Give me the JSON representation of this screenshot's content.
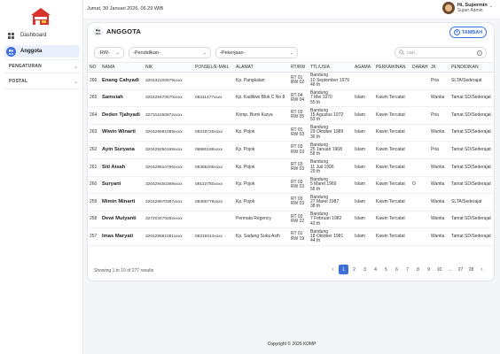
{
  "app": {
    "brand_color": "#3d6fd6",
    "logo_icon": "house-logo"
  },
  "sidebar": {
    "items": [
      {
        "label": "Dashboard",
        "icon": "grid-icon",
        "active": false
      },
      {
        "label": "Anggota",
        "icon": "users-icon",
        "active": true
      }
    ],
    "groups": [
      {
        "label": "PENGATURAN"
      },
      {
        "label": "POSTAL"
      }
    ]
  },
  "topbar": {
    "datetime": "Jumat, 30 Januari 2026, 06.29 WIB",
    "user_name": "Hi, Supermin",
    "user_role": "Super Admin"
  },
  "card": {
    "title": "ANGGOTA",
    "add_label": "TAMBAH",
    "filters": {
      "rw": "-RW-",
      "pendidikan": "-Pendidikan-",
      "pekerjaan": "-Pekerjaan-"
    },
    "search_placeholder": "cari.."
  },
  "table": {
    "headers": [
      "NO",
      "NAMA",
      "NIK",
      "PONSEL/E-MAIL",
      "ALAMAT",
      "RT/RW",
      "TTL/USIA",
      "AGAMA",
      "PERKAWINAN",
      "DARAH",
      "JK",
      "PENDIDIKAN"
    ],
    "rows": [
      {
        "no": "266",
        "nama": "Enang Cahyadi",
        "nik": "320432100979xxxx",
        "ponsel": "",
        "alamat": "Kp. Pangkalan",
        "rt": "RT 01",
        "rw": "RW 02",
        "ttl1": "Bandung",
        "ttl2": "10 September 1979",
        "ttl3": "46 th",
        "agama": "",
        "kawin": "",
        "darah": "",
        "jk": "Pria",
        "pend": "SLTA/Sederajat"
      },
      {
        "no": "265",
        "nama": "Samsiah",
        "nik": "320429470570xxxx",
        "ponsel": "08311477xxxx",
        "alamat": "Kp. Kadikiwi Blok C No 8",
        "rt": "RT 04",
        "rw": "RW 04",
        "ttl1": "Bandung",
        "ttl2": "7 Mei 1970",
        "ttl3": "55 th",
        "agama": "Islam",
        "kawin": "Kawin Tercatat",
        "darah": "",
        "jk": "Wanita",
        "pend": "Tamat SD/Sederajat"
      },
      {
        "no": "264",
        "nama": "Deden Tjahyadi",
        "nik": "327316150872xxxx",
        "ponsel": "",
        "alamat": "Komp. Bumi Karya",
        "rt": "RT 03",
        "rw": "RW 05",
        "ttl1": "Bandung",
        "ttl2": "15 Agustus 1972",
        "ttl3": "53 th",
        "agama": "Islam",
        "kawin": "Kawin Tercatat",
        "darah": "",
        "jk": "Pria",
        "pend": "Tamat SD/Sederajat"
      },
      {
        "no": "263",
        "nama": "Wiwin Winarti",
        "nik": "320429691089xxxx",
        "ponsel": "08318726xxxx",
        "alamat": "Kp. Pojok",
        "rt": "RT 01",
        "rw": "RW 03",
        "ttl1": "Bandung",
        "ttl2": "29 Oktober 1989",
        "ttl3": "36 th",
        "agama": "Islam",
        "kawin": "Kawin Tercatat",
        "darah": "",
        "jk": "Wanita",
        "pend": "Tamat SD/Sederajat"
      },
      {
        "no": "262",
        "nama": "Ayin Suryana",
        "nik": "320429250168xxxx",
        "ponsel": "08880189xxxx",
        "alamat": "Kp. Pojok",
        "rt": "RT 03",
        "rw": "RW 03",
        "ttl1": "Bandung",
        "ttl2": "25 Januari 1968",
        "ttl3": "58 th",
        "agama": "Islam",
        "kawin": "Kawin Tercatat",
        "darah": "",
        "jk": "Pria",
        "pend": "Tamat SD/Sederajat"
      },
      {
        "no": "261",
        "nama": "Siti Aisah",
        "nik": "320429510796xxxx",
        "ponsel": "08386206xxxx",
        "alamat": "Kp. Pojok",
        "rt": "RT 03",
        "rw": "RW 03",
        "ttl1": "Bandung",
        "ttl2": "11 Juli 1996",
        "ttl3": "29 th",
        "agama": "Islam",
        "kawin": "Kawin Tercatat",
        "darah": "",
        "jk": "Wanita",
        "pend": "Tamat SD/Sederajat"
      },
      {
        "no": "260",
        "nama": "Suryani",
        "nik": "320429450369xxxx",
        "ponsel": "08122750xxxx",
        "alamat": "Kp. Pojok",
        "rt": "RT 03",
        "rw": "RW 03",
        "ttl1": "Bandung",
        "ttl2": "5 Maret 1969",
        "ttl3": "56 th",
        "agama": "Islam",
        "kawin": "Kawin Tercatat",
        "darah": "O",
        "jk": "Wanita",
        "pend": "Tamat SD/Sederajat"
      },
      {
        "no": "259",
        "nama": "Mimin Minarti",
        "nik": "320429670387xxxx",
        "ponsel": "08386779xxxx",
        "alamat": "Kp. Pojok",
        "rt": "RT 03",
        "rw": "RW 03",
        "ttl1": "Bandung",
        "ttl2": "27 Maret 1987",
        "ttl3": "38 th",
        "agama": "Islam",
        "kawin": "Kawin Tercatat",
        "darah": "",
        "jk": "Wanita",
        "pend": "SLTA/Sederajat"
      },
      {
        "no": "258",
        "nama": "Dewi Mulyanti",
        "nik": "327203470282xxxx",
        "ponsel": "",
        "alamat": "Permata Regency",
        "rt": "RT 03",
        "rw": "RW 22",
        "ttl1": "Bandung",
        "ttl2": "7 Februari 1982",
        "ttl3": "43 th",
        "agama": "Islam",
        "kawin": "Kawin Tercatat",
        "darah": "",
        "jk": "Wanita",
        "pend": "Tamat SD/Sederajat"
      },
      {
        "no": "257",
        "nama": "Imas Maryati",
        "nik": "320429581081xxxx",
        "ponsel": "08319214xxxx",
        "alamat": "Kp. Sadang Suka Asih",
        "rt": "RT 01",
        "rw": "RW 19",
        "ttl1": "Bandung",
        "ttl2": "18 Oktober 1981",
        "ttl3": "44 th",
        "agama": "Islam",
        "kawin": "Kawin Tercatat",
        "darah": "",
        "jk": "Wanita",
        "pend": "Tamat SD/Sederajat"
      }
    ]
  },
  "pagination": {
    "results": "Showing 1 to 10 of 277 results",
    "prev": "‹",
    "next": "›",
    "pages": [
      "1",
      "2",
      "3",
      "4",
      "5",
      "6",
      "7",
      "8",
      "9",
      "10",
      "...",
      "27",
      "28"
    ],
    "current": "1"
  },
  "footer": {
    "copyright": "Copyright © 2026 KDMP"
  }
}
